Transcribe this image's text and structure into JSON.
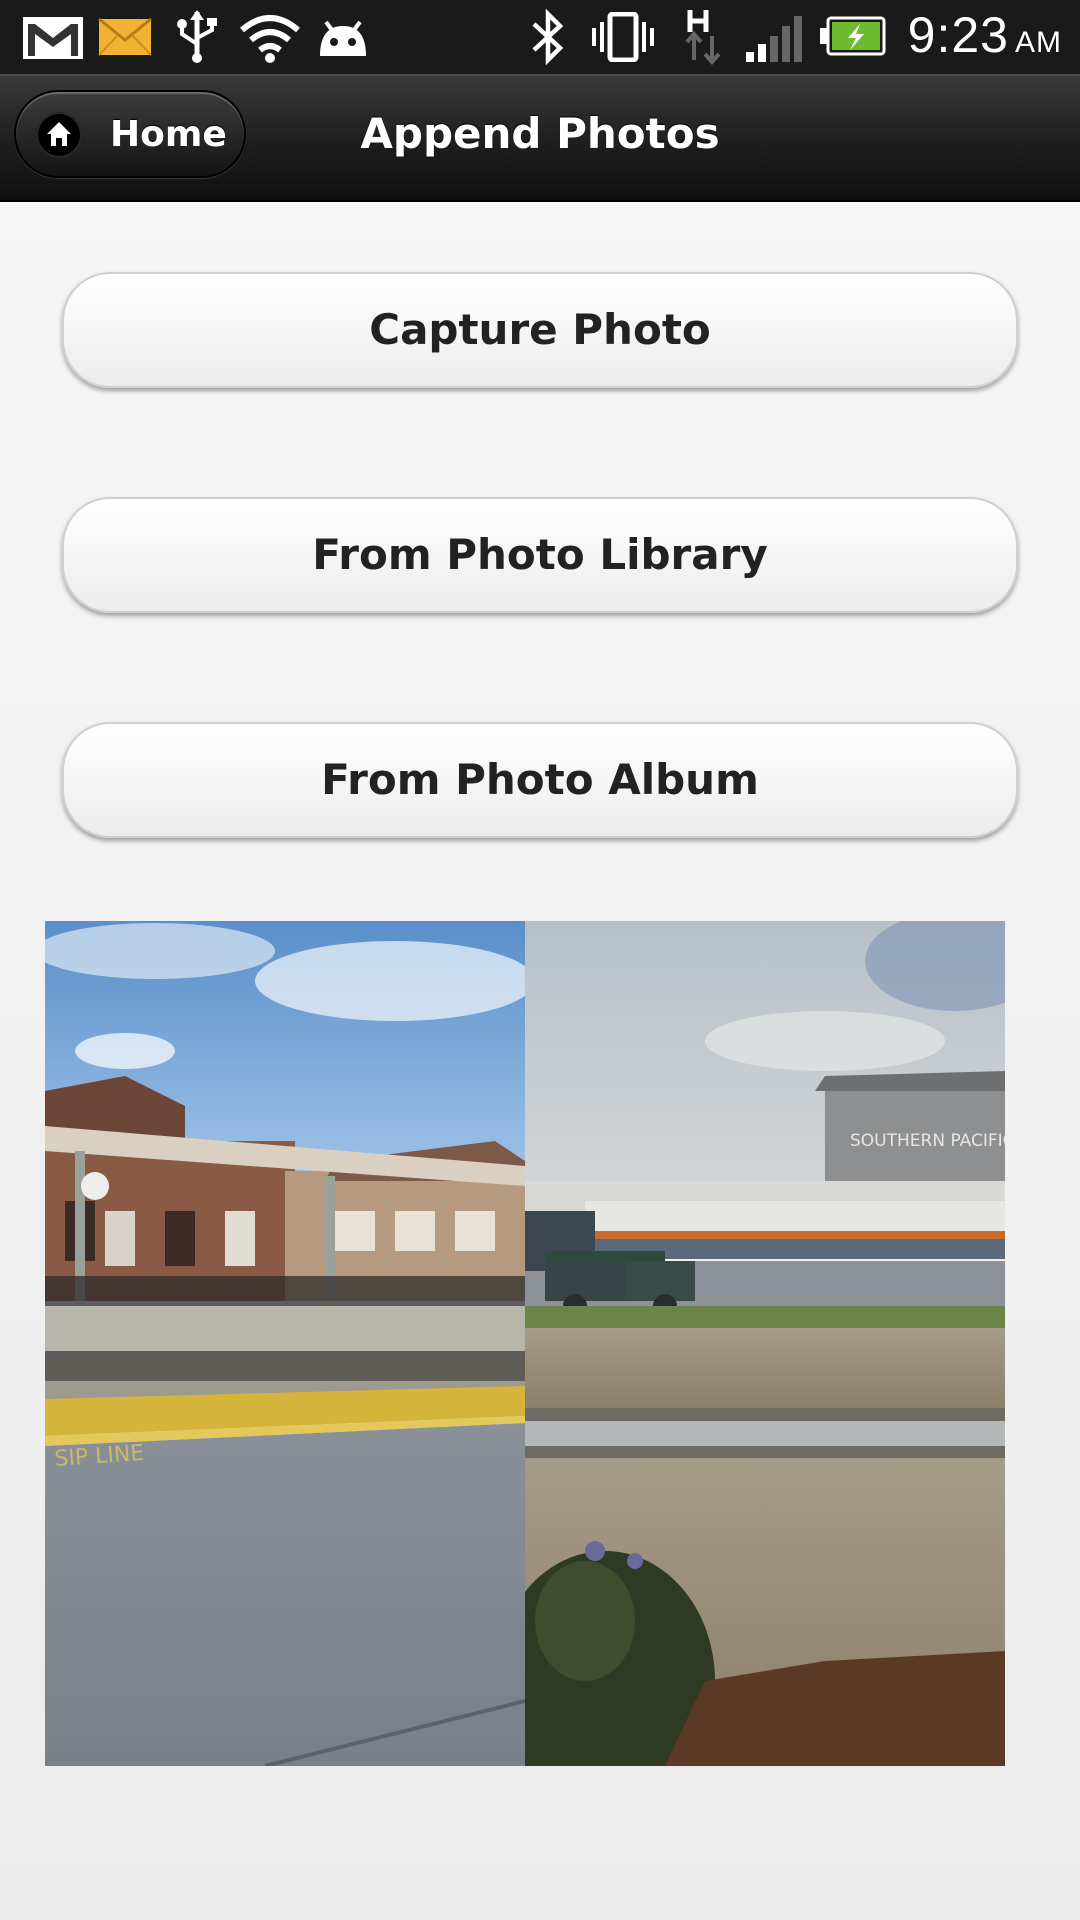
{
  "status_bar": {
    "time": "9:23",
    "ampm": "AM",
    "left_icons": [
      "gmail-icon",
      "email-icon",
      "usb-icon",
      "wifi-icon",
      "android-icon"
    ],
    "right_icons": [
      "bluetooth-icon",
      "vibrate-icon",
      "data-h-icon",
      "signal-icon",
      "battery-charging-icon"
    ]
  },
  "header": {
    "home_label": "Home",
    "title": "Append Photos"
  },
  "actions": {
    "capture_label": "Capture Photo",
    "library_label": "From Photo Library",
    "album_label": "From Photo Album"
  },
  "photos": {
    "left_sign": "SIP LINE",
    "right_sign": "SOUTHERN PACIFIC"
  },
  "colors": {
    "header_bg": "#1e1e1e",
    "button_bg": "#f4f4f4",
    "button_text": "#222222"
  }
}
